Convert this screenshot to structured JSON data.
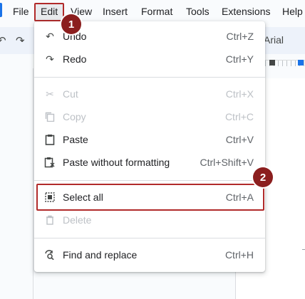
{
  "menubar": {
    "items": [
      "File",
      "Edit",
      "View",
      "Insert",
      "Format",
      "Tools",
      "Extensions",
      "Help"
    ]
  },
  "toolbar": {
    "font": "Arial"
  },
  "edit_menu": {
    "items": [
      {
        "label": "Undo",
        "shortcut": "Ctrl+Z",
        "icon": "undo-icon",
        "enabled": true
      },
      {
        "label": "Redo",
        "shortcut": "Ctrl+Y",
        "icon": "redo-icon",
        "enabled": true
      },
      {
        "label": "Cut",
        "shortcut": "Ctrl+X",
        "icon": "scissors-icon",
        "enabled": false
      },
      {
        "label": "Copy",
        "shortcut": "Ctrl+C",
        "icon": "copy-icon",
        "enabled": false
      },
      {
        "label": "Paste",
        "shortcut": "Ctrl+V",
        "icon": "clipboard-icon",
        "enabled": true
      },
      {
        "label": "Paste without formatting",
        "shortcut": "Ctrl+Shift+V",
        "icon": "clipboard-clear-format-icon",
        "enabled": true
      },
      {
        "label": "Select all",
        "shortcut": "Ctrl+A",
        "icon": "select-all-icon",
        "enabled": true
      },
      {
        "label": "Delete",
        "shortcut": "",
        "icon": "trash-icon",
        "enabled": false
      },
      {
        "label": "Find and replace",
        "shortcut": "Ctrl+H",
        "icon": "find-replace-icon",
        "enabled": true
      }
    ]
  },
  "annotations": {
    "step1": "1",
    "step2": "2"
  },
  "colors": {
    "highlight_border": "#b12a2a",
    "badge_fill": "#8b1e1e",
    "disabled_text": "#bdc1c6"
  }
}
